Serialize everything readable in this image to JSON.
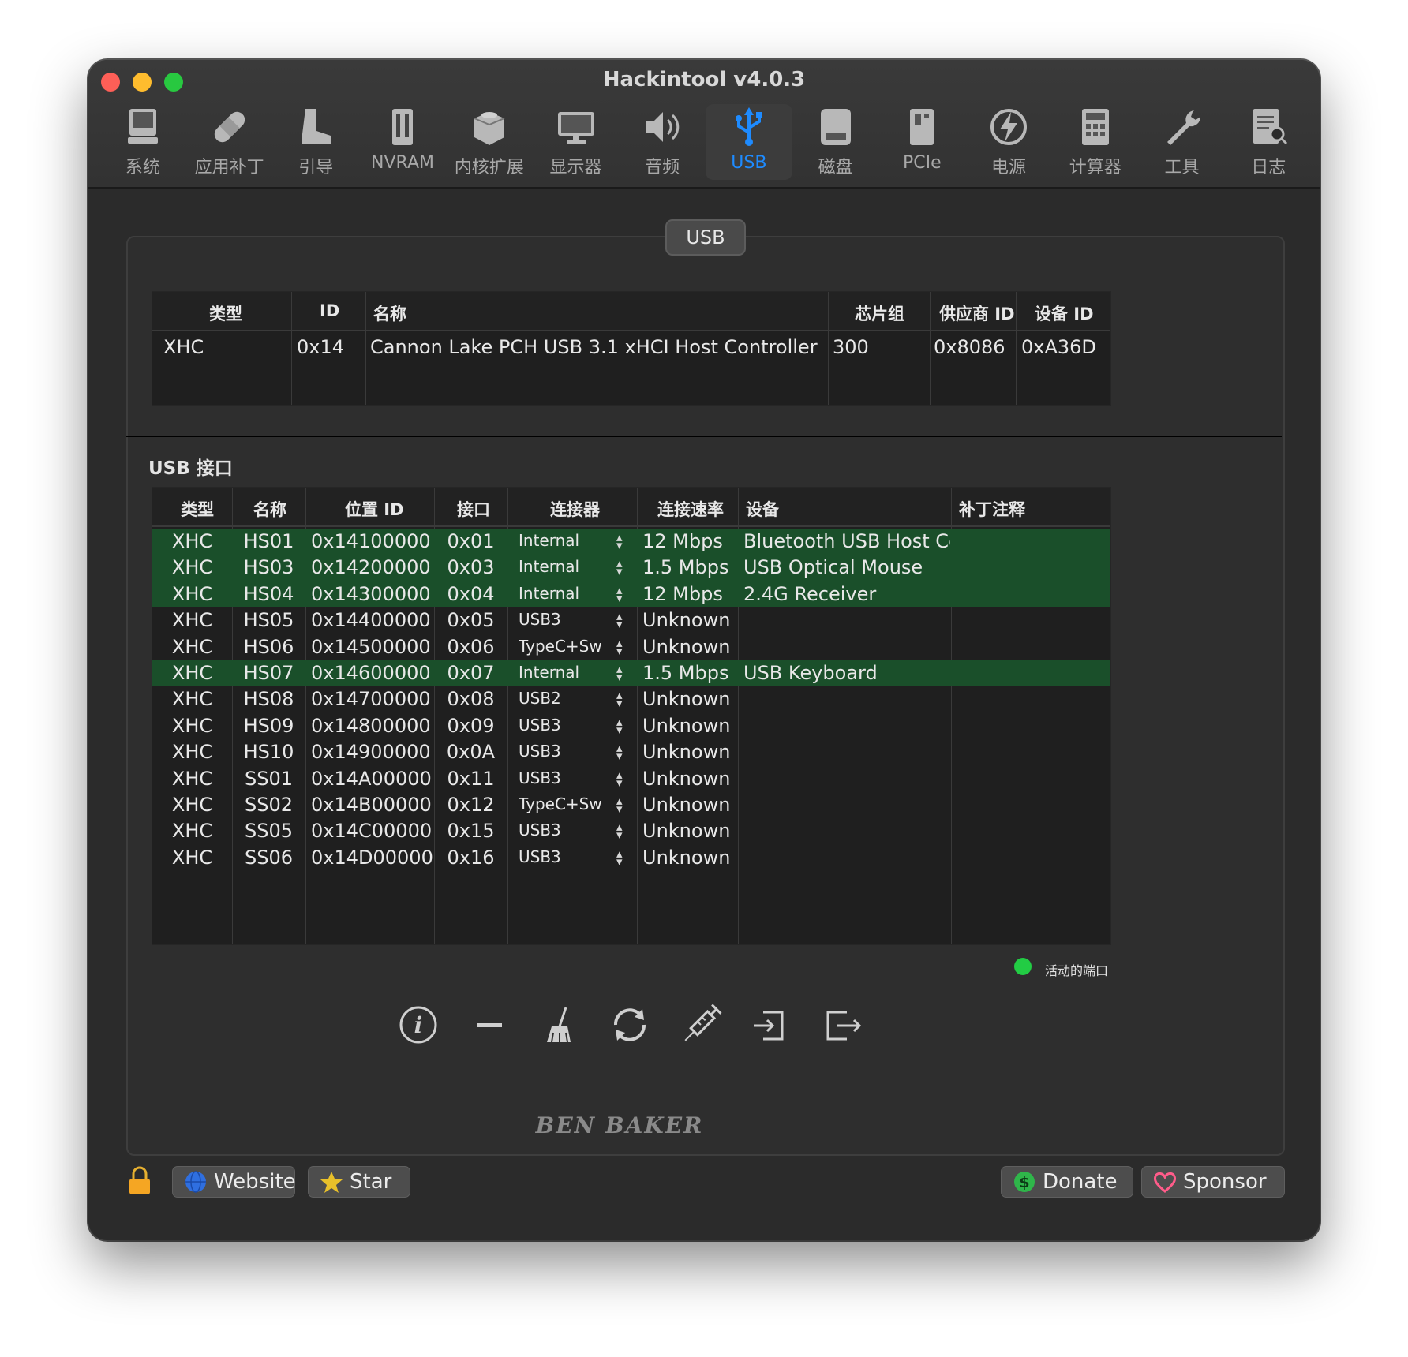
{
  "window": {
    "title": "Hackintool v4.0.3"
  },
  "toolbar": {
    "items": [
      {
        "label": "系统",
        "icon": "computer-icon"
      },
      {
        "label": "应用补丁",
        "icon": "bandage-icon"
      },
      {
        "label": "引导",
        "icon": "boot-icon"
      },
      {
        "label": "NVRAM",
        "icon": "nvram-chip-icon"
      },
      {
        "label": "内核扩展",
        "icon": "kext-box-icon"
      },
      {
        "label": "显示器",
        "icon": "display-icon"
      },
      {
        "label": "音频",
        "icon": "speaker-icon"
      },
      {
        "label": "USB",
        "icon": "usb-icon"
      },
      {
        "label": "磁盘",
        "icon": "disk-icon"
      },
      {
        "label": "PCIe",
        "icon": "pcie-card-icon"
      },
      {
        "label": "电源",
        "icon": "power-icon"
      },
      {
        "label": "计算器",
        "icon": "calculator-icon"
      },
      {
        "label": "工具",
        "icon": "wrench-icon"
      },
      {
        "label": "日志",
        "icon": "log-search-icon"
      }
    ],
    "active": "USB"
  },
  "usb_tab": {
    "label": "USB"
  },
  "controllers": {
    "headers": [
      "类型",
      "ID",
      "名称",
      "芯片组",
      "供应商 ID",
      "设备 ID"
    ],
    "rows": [
      [
        "XHC",
        "0x14",
        "Cannon Lake PCH USB 3.1 xHCI Host Controller",
        "300",
        "0x8086",
        "0xA36D"
      ]
    ]
  },
  "ports": {
    "section_title": "USB 接口",
    "headers": [
      "类型",
      "名称",
      "位置 ID",
      "接口",
      "连接器",
      "连接速率",
      "设备",
      "补丁注释"
    ],
    "rows": [
      {
        "type": "XHC",
        "name": "HS01",
        "location": "0x14100000",
        "port": "0x01",
        "connector": "Internal",
        "speed": "12 Mbps",
        "device": "Bluetooth USB Host Co...",
        "comment": "",
        "active": true
      },
      {
        "type": "XHC",
        "name": "HS03",
        "location": "0x14200000",
        "port": "0x03",
        "connector": "Internal",
        "speed": "1.5 Mbps",
        "device": "USB Optical Mouse",
        "comment": "",
        "active": true
      },
      {
        "type": "XHC",
        "name": "HS04",
        "location": "0x14300000",
        "port": "0x04",
        "connector": "Internal",
        "speed": "12 Mbps",
        "device": "2.4G Receiver",
        "comment": "",
        "active": true
      },
      {
        "type": "XHC",
        "name": "HS05",
        "location": "0x14400000",
        "port": "0x05",
        "connector": "USB3",
        "speed": "Unknown",
        "device": "",
        "comment": "",
        "active": false
      },
      {
        "type": "XHC",
        "name": "HS06",
        "location": "0x14500000",
        "port": "0x06",
        "connector": "TypeC+Sw",
        "speed": "Unknown",
        "device": "",
        "comment": "",
        "active": false
      },
      {
        "type": "XHC",
        "name": "HS07",
        "location": "0x14600000",
        "port": "0x07",
        "connector": "Internal",
        "speed": "1.5 Mbps",
        "device": "USB Keyboard",
        "comment": "",
        "active": true
      },
      {
        "type": "XHC",
        "name": "HS08",
        "location": "0x14700000",
        "port": "0x08",
        "connector": "USB2",
        "speed": "Unknown",
        "device": "",
        "comment": "",
        "active": false
      },
      {
        "type": "XHC",
        "name": "HS09",
        "location": "0x14800000",
        "port": "0x09",
        "connector": "USB3",
        "speed": "Unknown",
        "device": "",
        "comment": "",
        "active": false
      },
      {
        "type": "XHC",
        "name": "HS10",
        "location": "0x14900000",
        "port": "0x0A",
        "connector": "USB3",
        "speed": "Unknown",
        "device": "",
        "comment": "",
        "active": false
      },
      {
        "type": "XHC",
        "name": "SS01",
        "location": "0x14A00000",
        "port": "0x11",
        "connector": "USB3",
        "speed": "Unknown",
        "device": "",
        "comment": "",
        "active": false
      },
      {
        "type": "XHC",
        "name": "SS02",
        "location": "0x14B00000",
        "port": "0x12",
        "connector": "TypeC+Sw",
        "speed": "Unknown",
        "device": "",
        "comment": "",
        "active": false
      },
      {
        "type": "XHC",
        "name": "SS05",
        "location": "0x14C00000",
        "port": "0x15",
        "connector": "USB3",
        "speed": "Unknown",
        "device": "",
        "comment": "",
        "active": false
      },
      {
        "type": "XHC",
        "name": "SS06",
        "location": "0x14D00000",
        "port": "0x16",
        "connector": "USB3",
        "speed": "Unknown",
        "device": "",
        "comment": "",
        "active": false
      }
    ]
  },
  "legend": {
    "label": "活动的端口",
    "color": "#22cc44"
  },
  "actions": [
    "info-icon",
    "remove-icon",
    "broom-icon",
    "refresh-icon",
    "syringe-icon",
    "import-icon",
    "export-icon"
  ],
  "footer": {
    "lock_icon": "lock-icon",
    "website": "Website",
    "star": "Star",
    "brand": "BEN BAKER",
    "donate": "Donate",
    "sponsor": "Sponsor"
  },
  "colors": {
    "accent": "#1e8bff",
    "active_row": "#1a4f2a",
    "window_bg": "#2b2b2b"
  }
}
